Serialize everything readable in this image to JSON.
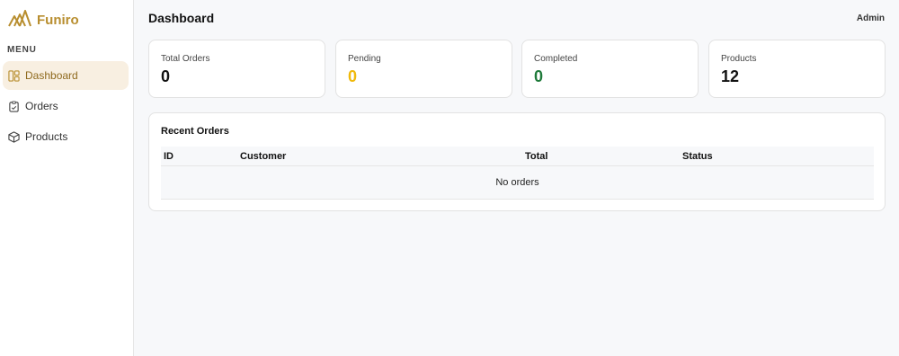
{
  "brand": {
    "name": "Funiro",
    "logo_icon": "funiro-logo-icon",
    "color": "#B88E2F"
  },
  "sidebar": {
    "menu_heading": "MENU",
    "items": [
      {
        "label": "Dashboard",
        "icon": "dashboard-icon",
        "active": true
      },
      {
        "label": "Orders",
        "icon": "clipboard-icon",
        "active": false
      },
      {
        "label": "Products",
        "icon": "box-icon",
        "active": false
      }
    ]
  },
  "header": {
    "title": "Dashboard",
    "user": "Admin"
  },
  "stats": [
    {
      "label": "Total Orders",
      "value": "0",
      "color": "#111111"
    },
    {
      "label": "Pending",
      "value": "0",
      "color": "#f0b90b"
    },
    {
      "label": "Completed",
      "value": "0",
      "color": "#1f7a3a"
    },
    {
      "label": "Products",
      "value": "12",
      "color": "#111111"
    }
  ],
  "recent_orders": {
    "title": "Recent Orders",
    "columns": [
      "ID",
      "Customer",
      "Total",
      "Status"
    ],
    "rows": [],
    "empty_text": "No orders"
  }
}
